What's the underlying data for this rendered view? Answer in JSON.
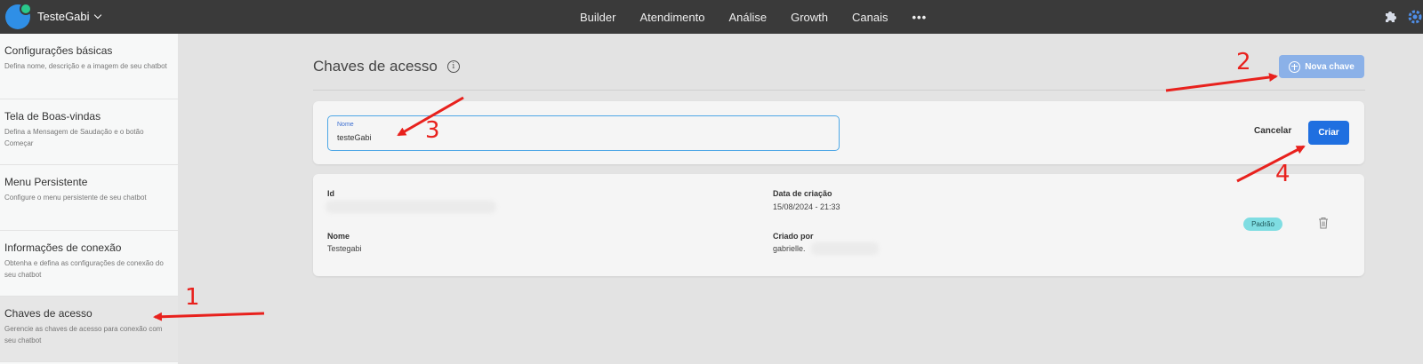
{
  "topbar": {
    "bot_name": "TesteGabi",
    "nav": [
      "Builder",
      "Atendimento",
      "Análise",
      "Growth",
      "Canais"
    ],
    "more": "•••"
  },
  "sidebar": {
    "items": [
      {
        "title": "Configurações básicas",
        "desc": "Defina nome, descrição e a imagem de seu chatbot"
      },
      {
        "title": "Tela de Boas-vindas",
        "desc": "Defina a Mensagem de Saudação e o botão Começar"
      },
      {
        "title": "Menu Persistente",
        "desc": "Configure o menu persistente de seu chatbot"
      },
      {
        "title": "Informações de conexão",
        "desc": "Obtenha e defina as configurações de conexão do seu chatbot"
      },
      {
        "title": "Chaves de acesso",
        "desc": "Gerencie as chaves de acesso para conexão com seu chatbot"
      }
    ]
  },
  "main": {
    "title": "Chaves de acesso",
    "new_key_label": "Nova chave",
    "form": {
      "name_label": "Nome",
      "name_value": "testeGabi",
      "cancel_label": "Cancelar",
      "create_label": "Criar"
    },
    "key": {
      "id_label": "Id",
      "created_label": "Data de criação",
      "created_value": "15/08/2024 - 21:33",
      "name_label": "Nome",
      "name_value": "Testegabi",
      "author_label": "Criado por",
      "author_value": "gabrielle.",
      "badge": "Padrão"
    }
  },
  "annotations": [
    "1",
    "2",
    "3",
    "4"
  ],
  "colors": {
    "topbar": "#3a3a3a",
    "primary": "#1f6fe0",
    "new_key_button": "#8bb1e8",
    "badge": "#7fdde2",
    "annotation": "#e8211d"
  }
}
